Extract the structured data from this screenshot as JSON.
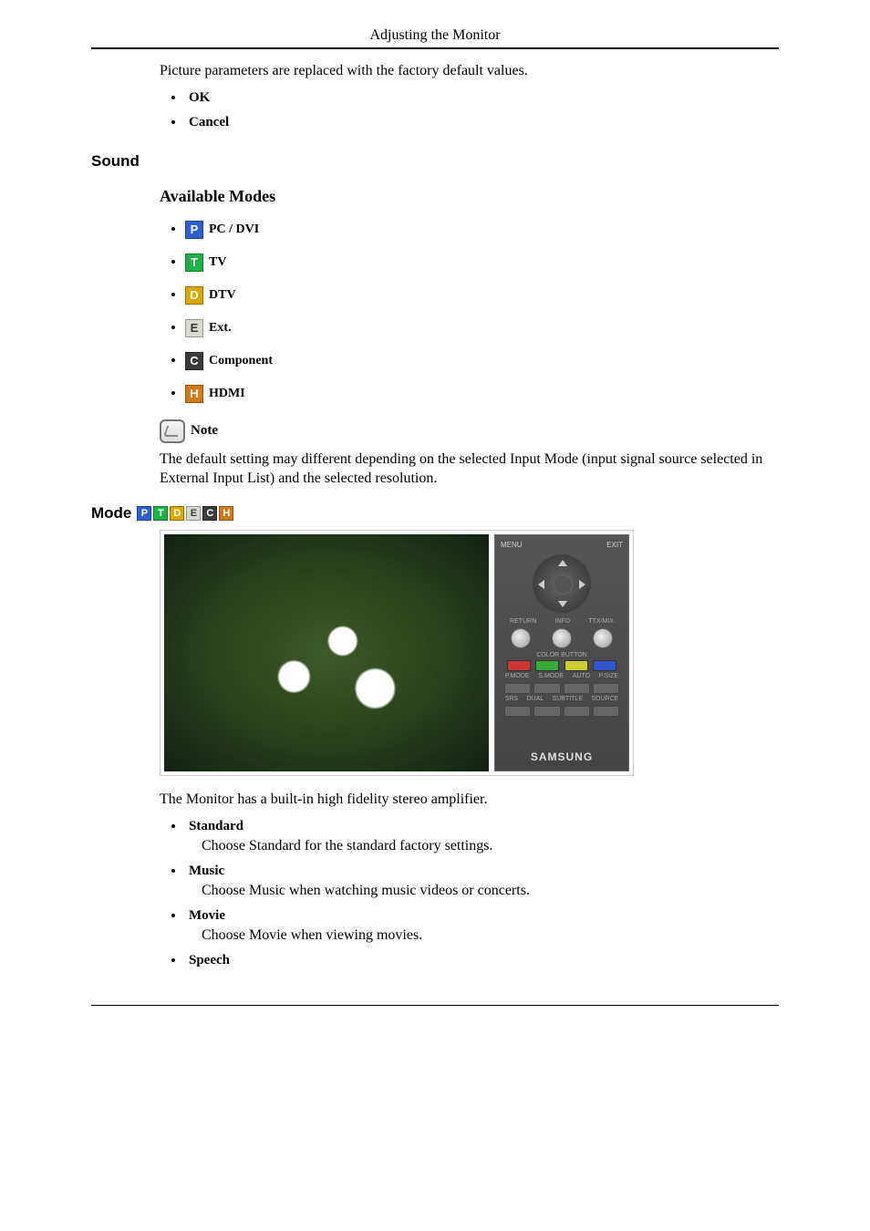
{
  "header": {
    "title": "Adjusting the Monitor"
  },
  "intro": {
    "text": "Picture parameters are replaced with the factory default values.",
    "options": [
      "OK",
      "Cancel"
    ]
  },
  "sound": {
    "heading": "Sound",
    "avail_heading": "Available Modes",
    "modes": [
      {
        "letter": "P",
        "cls": "bg-P",
        "label": "PC / DVI"
      },
      {
        "letter": "T",
        "cls": "bg-T",
        "label": "TV"
      },
      {
        "letter": "D",
        "cls": "bg-D",
        "label": "DTV"
      },
      {
        "letter": "E",
        "cls": "bg-E",
        "label": "Ext."
      },
      {
        "letter": "C",
        "cls": "bg-C",
        "label": "Component"
      },
      {
        "letter": "H",
        "cls": "bg-H",
        "label": "HDMI"
      }
    ],
    "note_label": "Note",
    "note_text": "The default setting may different depending on the selected Input Mode (input signal source selected in External Input List) and the selected resolution."
  },
  "mode": {
    "heading": "Mode",
    "icon_strip": [
      {
        "letter": "P",
        "cls": "bg-P"
      },
      {
        "letter": "T",
        "cls": "bg-T"
      },
      {
        "letter": "D",
        "cls": "bg-D"
      },
      {
        "letter": "E",
        "cls": "bg-E"
      },
      {
        "letter": "C",
        "cls": "bg-C"
      },
      {
        "letter": "H",
        "cls": "bg-H"
      }
    ],
    "remote": {
      "top_left": "MENU",
      "top_right": "EXIT",
      "row_labels": [
        "RETURN",
        "INFO",
        "TTX/MIX"
      ],
      "cb_label": "COLOR BUTTON",
      "btn_labels1": [
        "P.MODE",
        "S.MODE",
        "AUTO",
        "P.SIZE"
      ],
      "btn_labels2": [
        "SRS",
        "DUAL",
        "SUBTITLE",
        "SOURCE"
      ],
      "brand": "SAMSUNG"
    },
    "intro": "The Monitor has a built-in high fidelity stereo amplifier.",
    "items": [
      {
        "name": "Standard",
        "desc": "Choose Standard for the standard factory settings."
      },
      {
        "name": "Music",
        "desc": "Choose Music when watching music videos or concerts."
      },
      {
        "name": "Movie",
        "desc": "Choose Movie when viewing movies."
      },
      {
        "name": "Speech",
        "desc": ""
      }
    ]
  }
}
